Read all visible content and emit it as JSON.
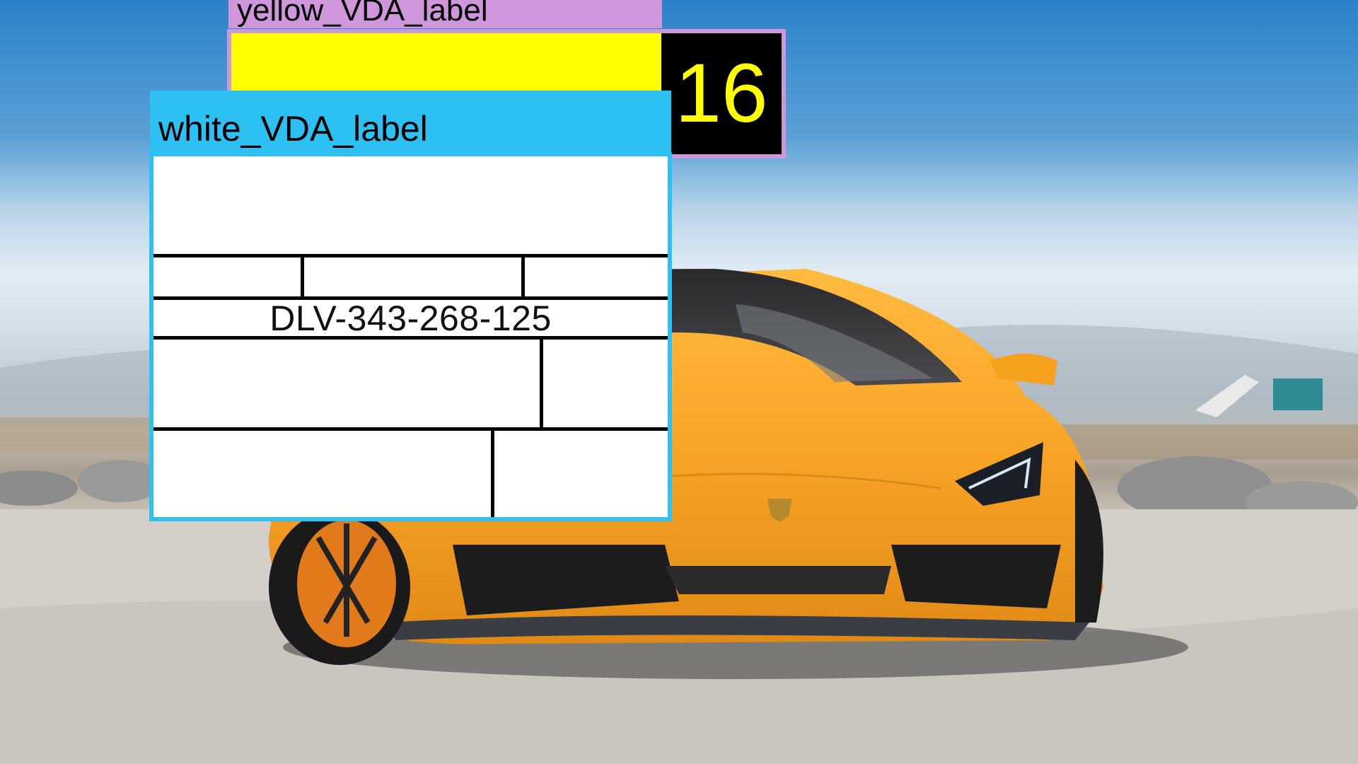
{
  "labels": {
    "yellow": {
      "header": "yellow_VDA_label",
      "count": "16",
      "colors": {
        "header": "#d096dc",
        "fill": "#ffff00",
        "count_bg": "#000000",
        "count_text": "#ffff00"
      }
    },
    "white": {
      "header": "white_VDA_label",
      "delivery_number": "DLV-343-268-125",
      "colors": {
        "header": "#2dc0f2",
        "fill": "#ffffff",
        "lines": "#000000"
      }
    }
  },
  "background": {
    "subject": "orange-sports-car-photo",
    "colors": {
      "sky": "#3f8fcf",
      "ground": "#d6d2cc",
      "car": "#f7a325"
    }
  }
}
